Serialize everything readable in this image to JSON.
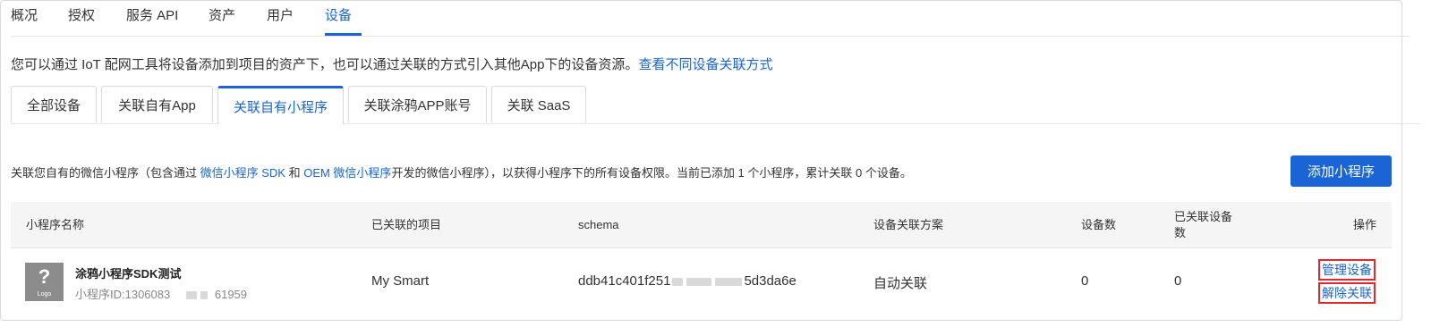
{
  "top_tabs": [
    "概况",
    "授权",
    "服务 API",
    "资产",
    "用户",
    "设备"
  ],
  "info": {
    "text": "您可以通过 IoT 配网工具将设备添加到项目的资产下，也可以通过关联的方式引入其他App下的设备资源。",
    "link": "查看不同设备关联方式"
  },
  "sub_tabs": [
    "全部设备",
    "关联自有App",
    "关联自有小程序",
    "关联涂鸦APP账号",
    "关联 SaaS"
  ],
  "desc": {
    "p1": "关联您自有的微信小程序（包含通过 ",
    "link1": "微信小程序 SDK",
    "p2": " 和 ",
    "link2": "OEM 微信小程序",
    "p3": "开发的微信小程序），以获得小程序下的所有设备权限。当前已添加 1 个小程序，累计关联 0 个设备。"
  },
  "add_button": "添加小程序",
  "table": {
    "headers": {
      "name": "小程序名称",
      "project": "已关联的项目",
      "schema": "schema",
      "scheme": "设备关联方案",
      "devices": "设备数",
      "linked_l1": "已关联设备",
      "linked_l2": "数",
      "ops": "操作"
    },
    "row": {
      "logo_q": "?",
      "logo_text": "Logo",
      "name": "涂鸦小程序SDK测试",
      "id_prefix": "小程序ID:1306083",
      "id_suffix": "61959",
      "project": "My Smart",
      "schema_prefix": "ddb41c401f251",
      "schema_suffix": "5d3da6e",
      "scheme": "自动关联",
      "devices": "0",
      "linked": "0",
      "op_manage": "管理设备",
      "op_unlink": "解除关联"
    }
  }
}
